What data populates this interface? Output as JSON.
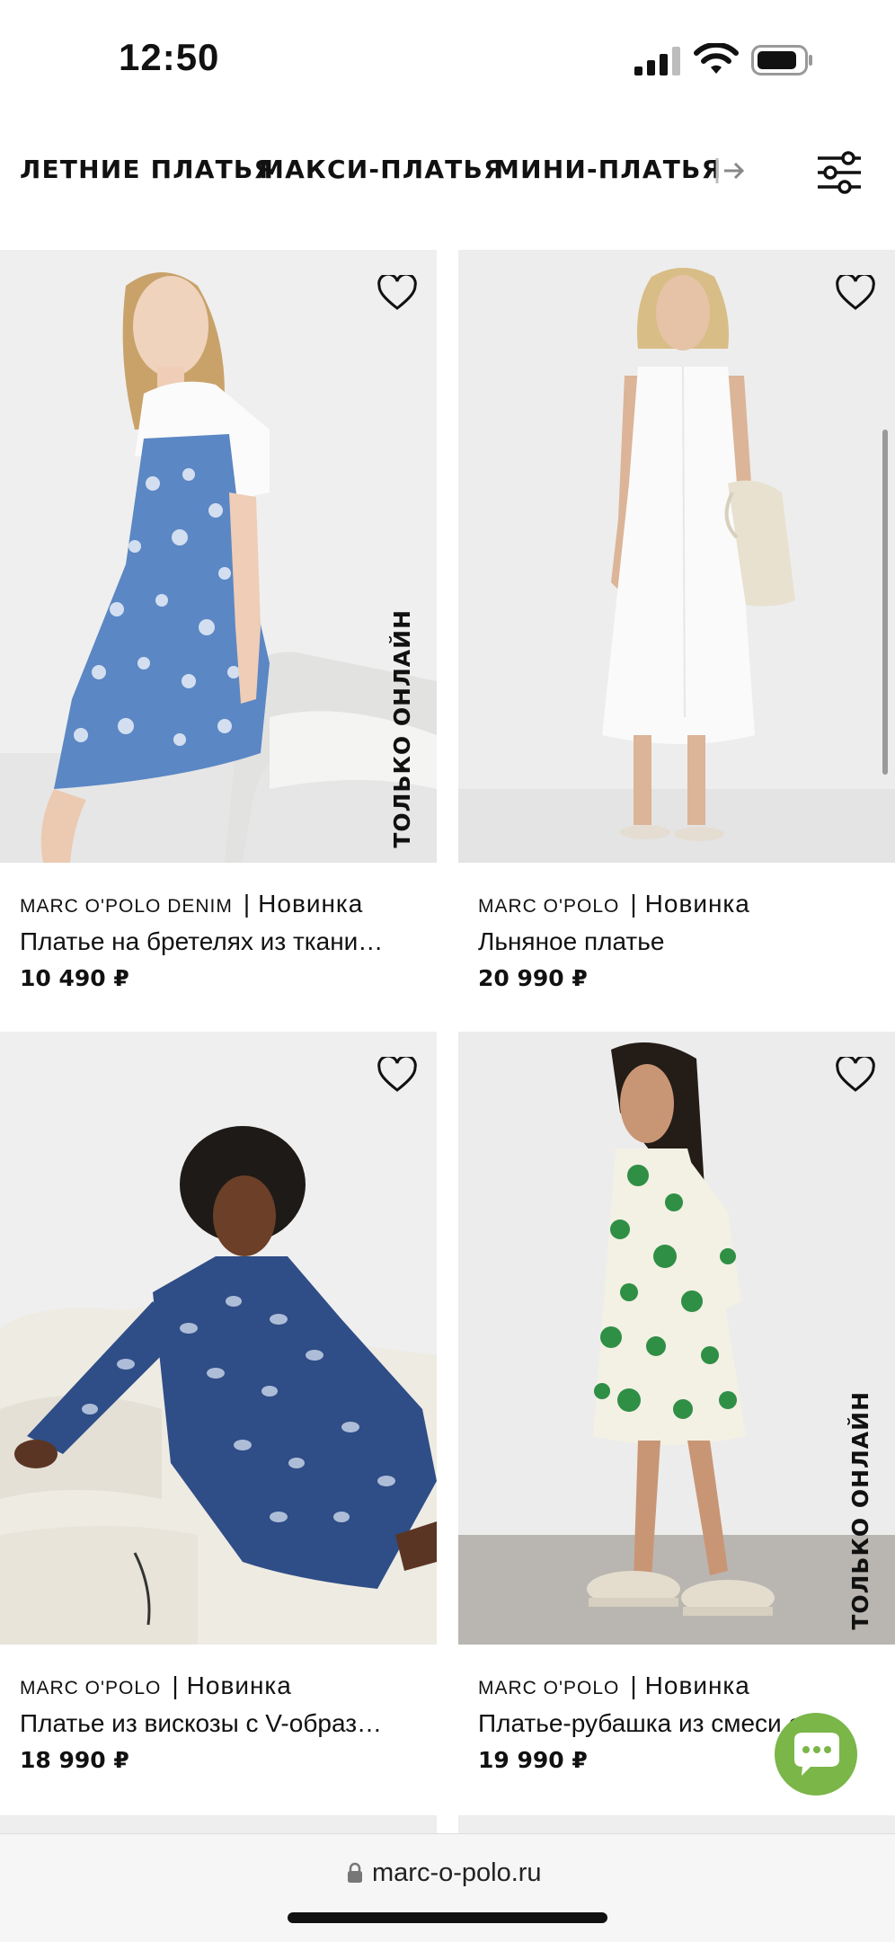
{
  "status_bar": {
    "time": "12:50"
  },
  "categories": [
    "ЛЕТНИЕ ПЛАТЬЯ",
    "МАКСИ-ПЛАТЬЯ",
    "МИНИ-ПЛАТЬЯ"
  ],
  "products": [
    {
      "brand": "MARC O'POLO DENIM",
      "separator": "|",
      "tag": "Новинка",
      "title": "Платье на бретелях из ткани…",
      "price": "10 490 ₽",
      "badge": "ТОЛЬКО ОНЛАЙН",
      "favorite": false
    },
    {
      "brand": "MARC O'POLO",
      "separator": "|",
      "tag": "Новинка",
      "title": "Льняное платье",
      "price": "20 990 ₽",
      "badge": "",
      "favorite": false
    },
    {
      "brand": "MARC O'POLO",
      "separator": "|",
      "tag": "Новинка",
      "title": "Платье из вискозы с V-образ…",
      "price": "18 990 ₽",
      "badge": "",
      "favorite": false
    },
    {
      "brand": "MARC O'POLO",
      "separator": "|",
      "tag": "Новинка",
      "title": "Платье-рубашка из смеси ор…",
      "price": "19 990 ₽",
      "badge": "ТОЛЬКО ОНЛАЙН",
      "favorite": false
    }
  ],
  "address_bar": {
    "url": "marc-o-polo.ru"
  },
  "colors": {
    "accent_chat": "#7ab648",
    "text": "#111111"
  },
  "icons": [
    "cellular-signal-icon",
    "wifi-icon",
    "battery-icon",
    "arrow-right-icon",
    "filter-sliders-icon",
    "heart-icon",
    "chat-icon",
    "lock-icon"
  ]
}
